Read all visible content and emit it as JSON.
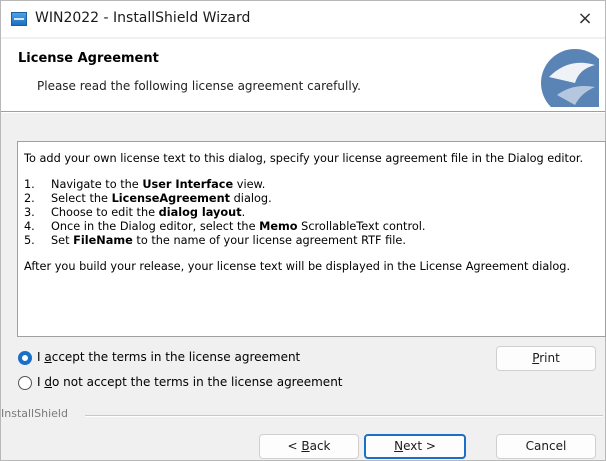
{
  "window": {
    "title": "WIN2022 - InstallShield Wizard",
    "close_glyph": "×",
    "icon": "installer-app-icon"
  },
  "header": {
    "title": "License Agreement",
    "subtitle": "Please read the following license agreement carefully.",
    "logo_icon": "installshield-logo-icon"
  },
  "license": {
    "intro": "To add your own license text to this dialog, specify your license agreement file in the Dialog editor.",
    "steps": [
      {
        "num": "1.",
        "pre": "Navigate to the ",
        "bold": "User Interface",
        "post": " view."
      },
      {
        "num": "2.",
        "pre": "Select the ",
        "bold": "LicenseAgreement",
        "post": " dialog."
      },
      {
        "num": "3.",
        "pre": "Choose to edit the ",
        "bold": "dialog layout",
        "post": "."
      },
      {
        "num": "4.",
        "pre": "Once in the Dialog editor, select the ",
        "bold": "Memo",
        "post": " ScrollableText control."
      },
      {
        "num": "5.",
        "pre": "Set ",
        "bold": "FileName",
        "post": " to the name of your license agreement RTF file."
      }
    ],
    "outro": "After you build your release, your license text will be displayed in the License Agreement dialog."
  },
  "options": {
    "accept": {
      "pre": "I ",
      "accel": "a",
      "post": "ccept the terms in the license agreement",
      "selected": true
    },
    "decline": {
      "pre": "I ",
      "accel": "d",
      "post": "o not accept the terms in the license agreement",
      "selected": false
    }
  },
  "buttons": {
    "print": {
      "accel": "P",
      "rest": "rint"
    },
    "back": {
      "pre": "< ",
      "accel": "B",
      "rest": "ack"
    },
    "next": {
      "accel": "N",
      "rest": "ext >"
    },
    "cancel": {
      "label": "Cancel"
    }
  },
  "footer": {
    "brand": "InstallShield"
  },
  "colors": {
    "accent": "#1a6fc9",
    "logo": "#3c6ea8"
  }
}
